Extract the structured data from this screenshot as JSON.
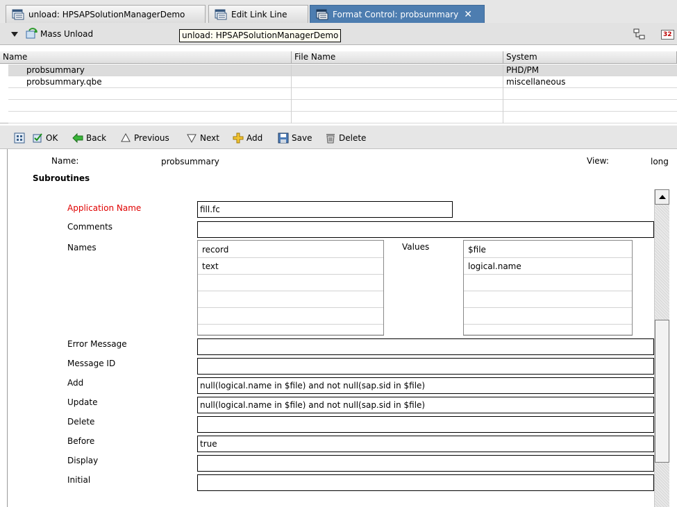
{
  "tabs": [
    {
      "label": "unload: HPSAPSolutionManagerDemo",
      "active": false
    },
    {
      "label": "Edit Link Line",
      "active": false
    },
    {
      "label": "Format Control: probsummary",
      "active": true
    }
  ],
  "unload_bar": {
    "title": "Mass Unload",
    "tooltip": "unload: HPSAPSolutionManagerDemo",
    "right_badge": "32"
  },
  "table": {
    "columns": [
      "Name",
      "File Name",
      "System"
    ],
    "rows": [
      {
        "name": "probsummary",
        "file": "",
        "system": "PHD/PM",
        "selected": true
      },
      {
        "name": "probsummary.qbe",
        "file": "",
        "system": "miscellaneous",
        "selected": false
      }
    ]
  },
  "toolbar": {
    "ok": "OK",
    "back": "Back",
    "previous": "Previous",
    "next": "Next",
    "add": "Add",
    "save": "Save",
    "delete": "Delete"
  },
  "form": {
    "name_label": "Name:",
    "name_value": "probsummary",
    "view_label": "View:",
    "view_value": "long",
    "section_title": "Subroutines",
    "application_name_label": "Application Name",
    "application_name_value": "fill.fc",
    "comments_label": "Comments",
    "comments_value": "",
    "names_label": "Names",
    "names": [
      "record",
      "text"
    ],
    "values_label": "Values",
    "values": [
      "$file",
      "logical.name"
    ],
    "error_message_label": "Error Message",
    "error_message_value": "",
    "message_id_label": "Message ID",
    "message_id_value": "",
    "add_label": "Add",
    "add_value": "null(logical.name in $file) and not null(sap.sid in $file)",
    "update_label": "Update",
    "update_value": "null(logical.name in $file) and not null(sap.sid in $file)",
    "delete_label": "Delete",
    "delete_value": "",
    "before_label": "Before",
    "before_value": "true",
    "display_label": "Display",
    "display_value": "",
    "initial_label": "Initial",
    "initial_value": ""
  },
  "colors": {
    "active_tab": "#4d7db0",
    "required_label": "#e00000",
    "toolbar_bg": "#e6e6e6"
  }
}
